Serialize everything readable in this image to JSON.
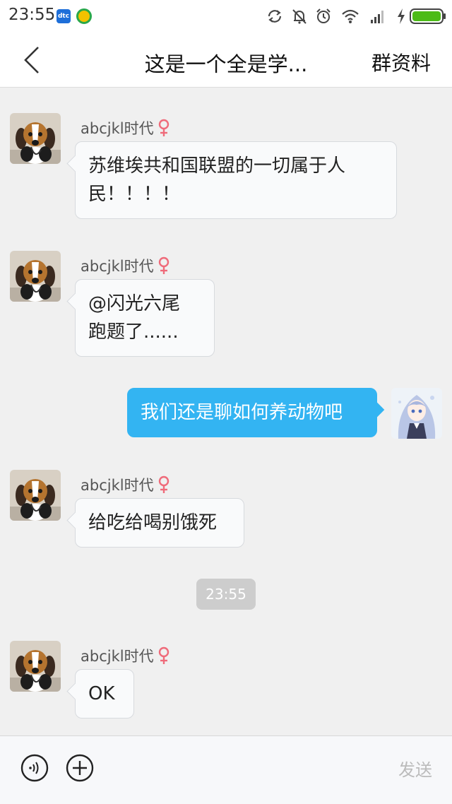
{
  "status_bar": {
    "time": "23:55",
    "app_badge_text": "dtc",
    "icons": [
      "sync-icon",
      "mute-bell-icon",
      "alarm-icon",
      "wifi-icon",
      "signal-icon",
      "charging-icon",
      "battery-icon"
    ]
  },
  "header": {
    "title": "这是一个全是学...",
    "group_info": "群资料"
  },
  "messages": [
    {
      "direction": "in",
      "sender": "abcjkl时代",
      "gender": "female",
      "line1": "苏维埃共和国联盟的一切属于人",
      "line2": "民！！！！"
    },
    {
      "direction": "in",
      "sender": "abcjkl时代",
      "gender": "female",
      "line1": "@闪光六尾",
      "line2": "跑题了......"
    },
    {
      "direction": "out",
      "text": "我们还是聊如何养动物吧"
    },
    {
      "direction": "in",
      "sender": "abcjkl时代",
      "gender": "female",
      "text": "给吃给喝别饿死"
    },
    {
      "direction": "in",
      "sender": "abcjkl时代",
      "gender": "female",
      "text": "OK"
    }
  ],
  "timestamp_divider": "23:55",
  "input_bar": {
    "send_label": "发送"
  },
  "colors": {
    "outgoing_bubble": "#33b4f2",
    "incoming_bubble": "#f9fafb",
    "background": "#f0f0f0",
    "gender_female": "#ef6b7a",
    "battery_green": "#4cbb17"
  }
}
